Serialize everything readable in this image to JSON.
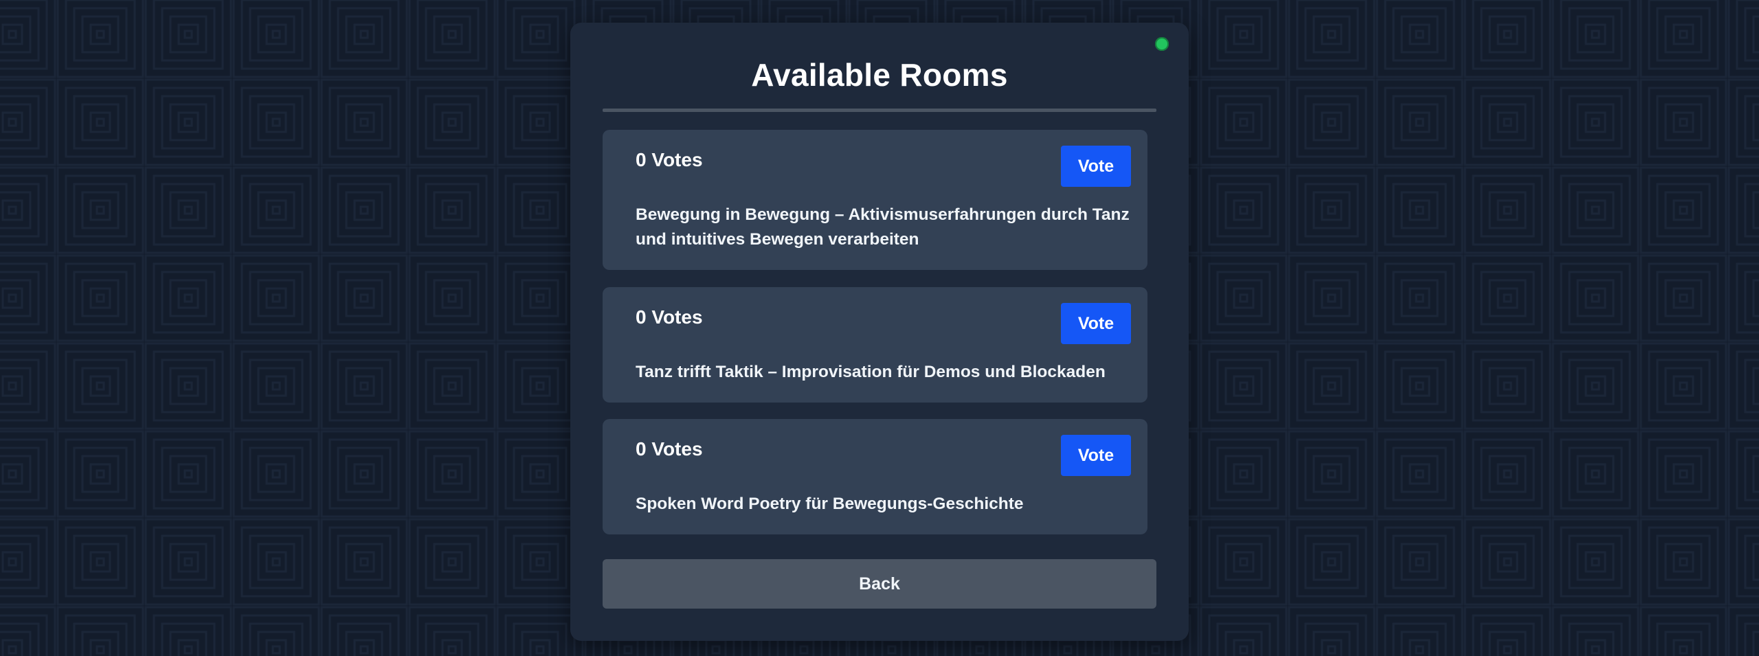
{
  "page": {
    "title": "Available Rooms",
    "status_color": "#22c55e",
    "accent_color": "#1557f6"
  },
  "rooms": [
    {
      "votes": "0 Votes",
      "vote_label": "Vote",
      "title": "Bewegung in Bewegung – Aktivismuserfahrungen durch Tanz und intuitives Bewegen verarbeiten"
    },
    {
      "votes": "0 Votes",
      "vote_label": "Vote",
      "title": "Tanz trifft Taktik – Improvisation für Demos und Blockaden"
    },
    {
      "votes": "0 Votes",
      "vote_label": "Vote",
      "title": "Spoken Word Poetry für Bewegungs-Geschichte"
    }
  ],
  "footer": {
    "back_label": "Back"
  }
}
